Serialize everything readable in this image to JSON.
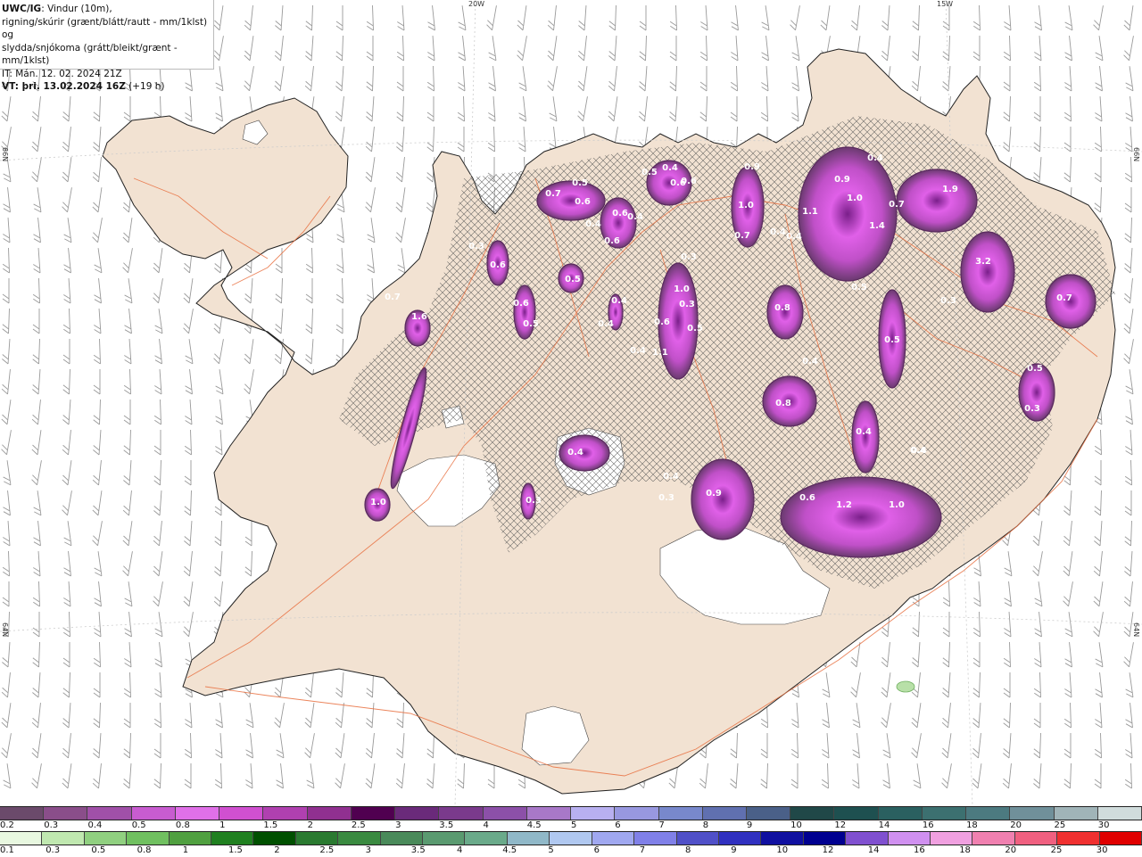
{
  "header": {
    "product": "UWC/IG",
    "line1_rest": ": Vindur (10m),",
    "line2": "rigning/skúrir (grænt/blátt/rautt - mm/1klst) og",
    "line3": "slydda/snjókoma (grátt/bleikt/grænt - mm/1klst)",
    "line4": "IT: Mán. 12. 02. 2024 21Z",
    "line5_bold": "VT: þri. 13.02.2024 16Z",
    "line5_rest": " (+19 h)"
  },
  "coords": {
    "lon_20w": "20W",
    "lon_15w": "15W",
    "lat_66_left": "66N",
    "lat_66_right": "66N",
    "lat_64_left": "64N",
    "lat_64_right": "64N"
  },
  "precip_labels": [
    "0.7",
    "0.5",
    "0.6",
    "0.4",
    "0.6",
    "0.6",
    "0.4",
    "0.5",
    "0.4",
    "0.6",
    "0.6",
    "0.9",
    "1.0",
    "0.7",
    "0.4",
    "0.4",
    "1.1",
    "1.0",
    "0.9",
    "0.4",
    "1.9",
    "0.7",
    "1.4",
    "3.2",
    "0.3",
    "0.5",
    "0.7",
    "0.5",
    "0.3",
    "0.8",
    "1.0",
    "0.3",
    "0.4",
    "0.5",
    "0.6",
    "0.6",
    "0.5",
    "0.4",
    "1.1",
    "0.4",
    "0.4",
    "0.5",
    "0.6",
    "0.3",
    "0.8",
    "0.4",
    "0.3",
    "0.4",
    "1.0",
    "0.4",
    "0.9",
    "0.3",
    "0.4",
    "0.6",
    "1.2",
    "1.0",
    "0.3",
    "0.5",
    "0.4",
    "0.7",
    "1.6"
  ],
  "legend_snow": {
    "labels": [
      "0.2",
      "0.3",
      "0.4",
      "0.5",
      "0.8",
      "1",
      "1.5",
      "2",
      "2.5",
      "3",
      "3.5",
      "4",
      "4.5",
      "5",
      "6",
      "7",
      "8",
      "9",
      "10",
      "12",
      "14",
      "16",
      "18",
      "20",
      "25",
      "30"
    ],
    "colors": [
      "#6b4a6b",
      "#8a4e8a",
      "#a050a8",
      "#c85cd0",
      "#e070e8",
      "#d050d0",
      "#b040b0",
      "#903090",
      "#500050",
      "#6a2a7a",
      "#7a3a8c",
      "#8c50a8",
      "#a878c8",
      "#b8b0f0",
      "#9898e0",
      "#7888cc",
      "#6070b0",
      "#4a6088",
      "#204848",
      "#1e5050",
      "#2a6060",
      "#3c7070",
      "#4c7a80",
      "#70909a",
      "#a0b4b8",
      "#d0dcdc"
    ]
  },
  "legend_rain": {
    "labels": [
      "0.1",
      "0.3",
      "0.5",
      "0.8",
      "1",
      "1.5",
      "2",
      "2.5",
      "3",
      "3.5",
      "4",
      "4.5",
      "5",
      "6",
      "7",
      "8",
      "9",
      "10",
      "12",
      "14",
      "16",
      "18",
      "20",
      "25",
      "30"
    ],
    "colors": [
      "#e8f8e0",
      "#c0e8b0",
      "#90d080",
      "#70c060",
      "#50a040",
      "#208020",
      "#005000",
      "#2a7a30",
      "#3a8a40",
      "#4a8a5a",
      "#5a9a70",
      "#6aaa8a",
      "#90b8c8",
      "#b0c8f0",
      "#a0a8f0",
      "#8080e8",
      "#5050c8",
      "#3030c0",
      "#1010a0",
      "#000090",
      "#8050d0",
      "#d090f0",
      "#f0a0e0",
      "#f080b0",
      "#f06080",
      "#f03030",
      "#e00000"
    ]
  }
}
